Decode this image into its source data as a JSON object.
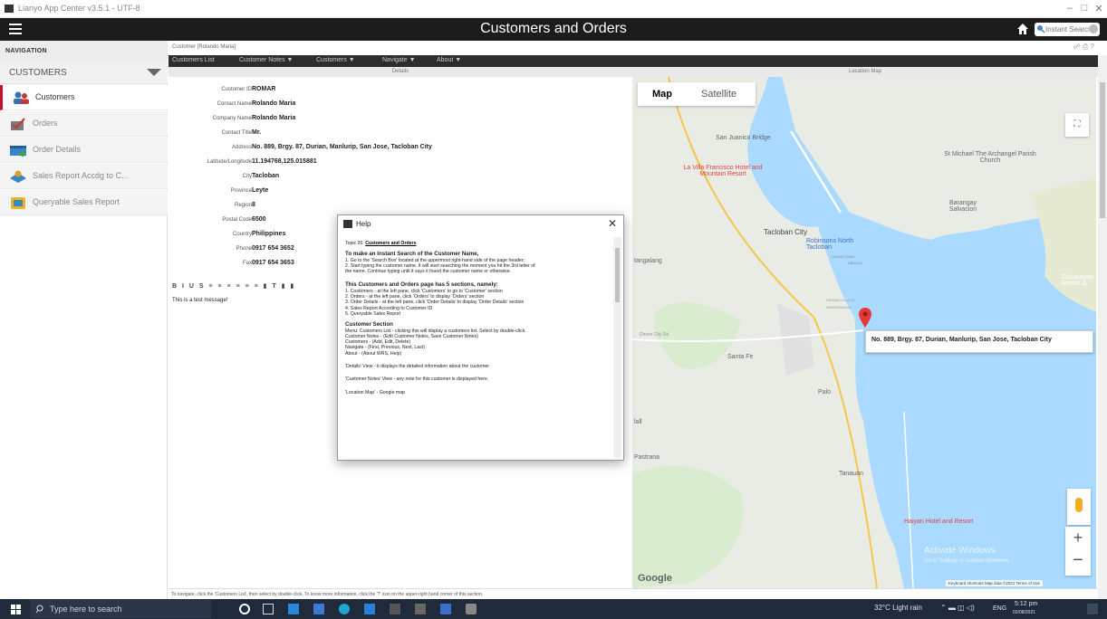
{
  "window": {
    "title": "Lianyo App Center v3.5.1 - UTF-8",
    "controls": [
      "–",
      "□",
      "✕"
    ]
  },
  "header": {
    "title": "Customers and Orders",
    "search_placeholder": "Instant Search"
  },
  "sidebar": {
    "nav_title": "NAVIGATION",
    "section_title": "CUSTOMERS",
    "items": [
      {
        "label": "Customers",
        "icon": "customers-icon",
        "active": true
      },
      {
        "label": "Orders",
        "icon": "orders-icon"
      },
      {
        "label": "Order Details",
        "icon": "order-details-icon"
      },
      {
        "label": "Sales Report Accdg to C...",
        "icon": "sales-report-icon"
      },
      {
        "label": "Queryable Sales Report",
        "icon": "queryable-report-icon"
      }
    ]
  },
  "breadcrumb": "Customer [Rolando Maria]",
  "toolbar_icons": "☍ ⎙ ?",
  "menu": [
    "Customers List",
    "Customer Notes ▼",
    "Customers ▼",
    "Navigate ▼",
    "About ▼"
  ],
  "details_header": "Details",
  "map_header": "Location Map",
  "fields": [
    {
      "label": "Customer ID",
      "value": "ROMAR"
    },
    {
      "label": "Contact Name",
      "value": "Rolando Maria"
    },
    {
      "label": "Company Name",
      "value": "Rolando Maria"
    },
    {
      "label": "Contact Title",
      "value": "Mr."
    },
    {
      "label": "Address",
      "value": "No. 889, Brgy. 87, Durian, Manlurip, San Jose, Tacloban City"
    },
    {
      "label": "Latitude/Longitude",
      "value": "11.194768,125.015881"
    },
    {
      "label": "City",
      "value": "Tacloban"
    },
    {
      "label": "Province",
      "value": "Leyte"
    },
    {
      "label": "Region",
      "value": "8"
    },
    {
      "label": "Postal Code",
      "value": "6500"
    },
    {
      "label": "Country",
      "value": "Philippines"
    },
    {
      "label": "Phone",
      "value": "0917 654 3652"
    },
    {
      "label": "Fax",
      "value": "0917 654 3653"
    }
  ],
  "rte_toolbar": "B I U S ≡ ≡ ≡ ≡ ≡ ≡   ▮ T ▮ ▮",
  "notes_text": "This is a test message!",
  "footer_text": "To navigate, click the 'Customers List', then select by double-click. To know more information, click the '?' icon on the upper-right hand corner of this section.",
  "map": {
    "map_btn": "Map",
    "satellite_btn": "Satellite",
    "places": {
      "san_juanico": "San Juanico Bridge",
      "st_michael": "St Michael The Archangel Parish Church",
      "la_villa": "La Villa Francisco Hotel and Mountain Resort",
      "tacloban": "Tacloban City",
      "robinsons": "Robinsons North Tacloban",
      "downtown": "DOWNTOWN",
      "abucay": "ABUCAY",
      "barangay_salvacion": "Barangay Salvacion",
      "caluwayan": "Caluwayan Resort &",
      "fatima": "FATIMA VILLAGE",
      "marasbaras": "MARASBARAS",
      "santa_fe": "Santa Fe",
      "palo": "Palo",
      "tanauan": "Tanauan",
      "pastrana": "Pastrana",
      "tangalang": "tangalang",
      "haiyan": "Haiyan Hotel and Resort",
      "dirsen": "Dirsen City Rd",
      "lall": "lall",
      "activate": "Activate Windows",
      "activate_sub": "Go to Settings to activate Windows.",
      "google": "Google",
      "attrib": "Keyboard shortcuts   Map data ©2021   Terms of Use"
    },
    "info_window": "No. 889, Brgy. 87, Durian, Manlurip, San Jose, Tacloban City"
  },
  "help": {
    "title": "Help",
    "topic_prefix": "Topic 26: ",
    "topic_link": "Customers and Orders",
    "paras": [
      {
        "h": "To make an Instant Search of the Customer Name,",
        "lines": [
          "1. Go to the 'Search Box' located at the uppermost right-hand side of the page header;",
          "2. Start typing the customer name. It will start searching the moment you hit the 3rd letter of",
          "the name. Continue typing until it says it found the customer name or otherwise."
        ]
      },
      {
        "h": "This Customers and Orders page has 5 sections, namely:",
        "lines": [
          "1. Customers    - at the left pane, click 'Customers' to go to 'Customer' section",
          "2. Orders        - at the left pane, click 'Orders' to display 'Orders' section",
          "3. Order Details - at the left pane, click 'Order Details' to display 'Order Details' section",
          "4. Sales Report According to Customer ID",
          "5. Queryable Sales Report"
        ]
      },
      {
        "h": "Customer Section",
        "lines": [
          "Menu: Customers List - clicking this will display a customers list. Select by double-click.",
          "        Customer Notes - (Edit Customer Notes, Save Customer Notes)",
          "            Customers - (Add, Edit, Delete)",
          "        Navigate - (First, Previous, Next, Last)",
          "        About - (About WRS, Help)"
        ]
      },
      {
        "h": "",
        "lines": [
          "'Details' View - it displays the detailed information about the customer"
        ]
      },
      {
        "h": "",
        "lines": [
          "'Customer Notes' View - any note for this customer is displayed here."
        ]
      },
      {
        "h": "",
        "lines": [
          "'Location Map' - Google map"
        ]
      }
    ]
  },
  "taskbar": {
    "search_text": "Type here to search",
    "weather": "32°C  Light rain",
    "lang": "ENG",
    "time": "5:12 pm",
    "date": "02/08/2021"
  }
}
